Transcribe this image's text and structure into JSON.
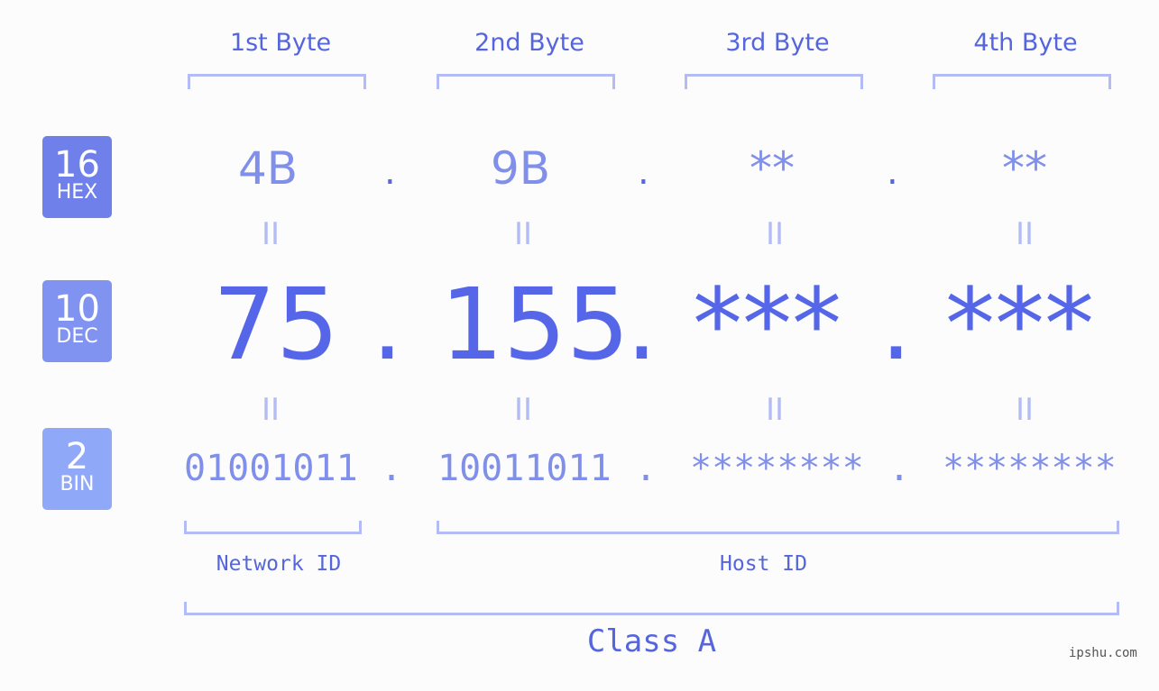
{
  "headers": [
    "1st Byte",
    "2nd Byte",
    "3rd Byte",
    "4th Byte"
  ],
  "badges": [
    {
      "num": "16",
      "label": "HEX",
      "color": "#7080ea"
    },
    {
      "num": "10",
      "label": "DEC",
      "color": "#8093f0"
    },
    {
      "num": "2",
      "label": "BIN",
      "color": "#90a8f8"
    }
  ],
  "hex": [
    "4B",
    "9B",
    "**",
    "**"
  ],
  "dec": [
    "75",
    "155",
    "***",
    "***"
  ],
  "bin": [
    "01001011",
    "10011011",
    "********",
    "********"
  ],
  "separator": ".",
  "equals": "II",
  "network_label": "Network ID",
  "host_label": "Host ID",
  "class_label": "Class A",
  "watermark": "ipshu.com"
}
